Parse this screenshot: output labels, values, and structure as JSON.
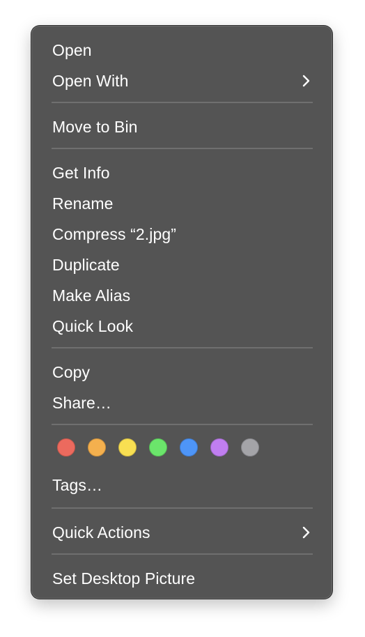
{
  "menu": {
    "open": "Open",
    "open_with": "Open With",
    "move_to_bin": "Move to Bin",
    "get_info": "Get Info",
    "rename": "Rename",
    "compress": "Compress “2.jpg”",
    "duplicate": "Duplicate",
    "make_alias": "Make Alias",
    "quick_look": "Quick Look",
    "copy": "Copy",
    "share": "Share…",
    "tags": "Tags…",
    "quick_actions": "Quick Actions",
    "set_desktop_picture": "Set Desktop Picture"
  },
  "tag_colors": [
    {
      "name": "red",
      "fill": "#ec6a5e",
      "stroke": "#c4574c"
    },
    {
      "name": "orange",
      "fill": "#f4b04e",
      "stroke": "#c98f3d"
    },
    {
      "name": "yellow",
      "fill": "#f8df52",
      "stroke": "#cbb641"
    },
    {
      "name": "green",
      "fill": "#6be56b",
      "stroke": "#55ba55"
    },
    {
      "name": "blue",
      "fill": "#4e95f7",
      "stroke": "#3e79cb"
    },
    {
      "name": "purple",
      "fill": "#c07ef0",
      "stroke": "#9c66c4"
    },
    {
      "name": "gray",
      "fill": "#a4a4a8",
      "stroke": "#85858a"
    }
  ]
}
